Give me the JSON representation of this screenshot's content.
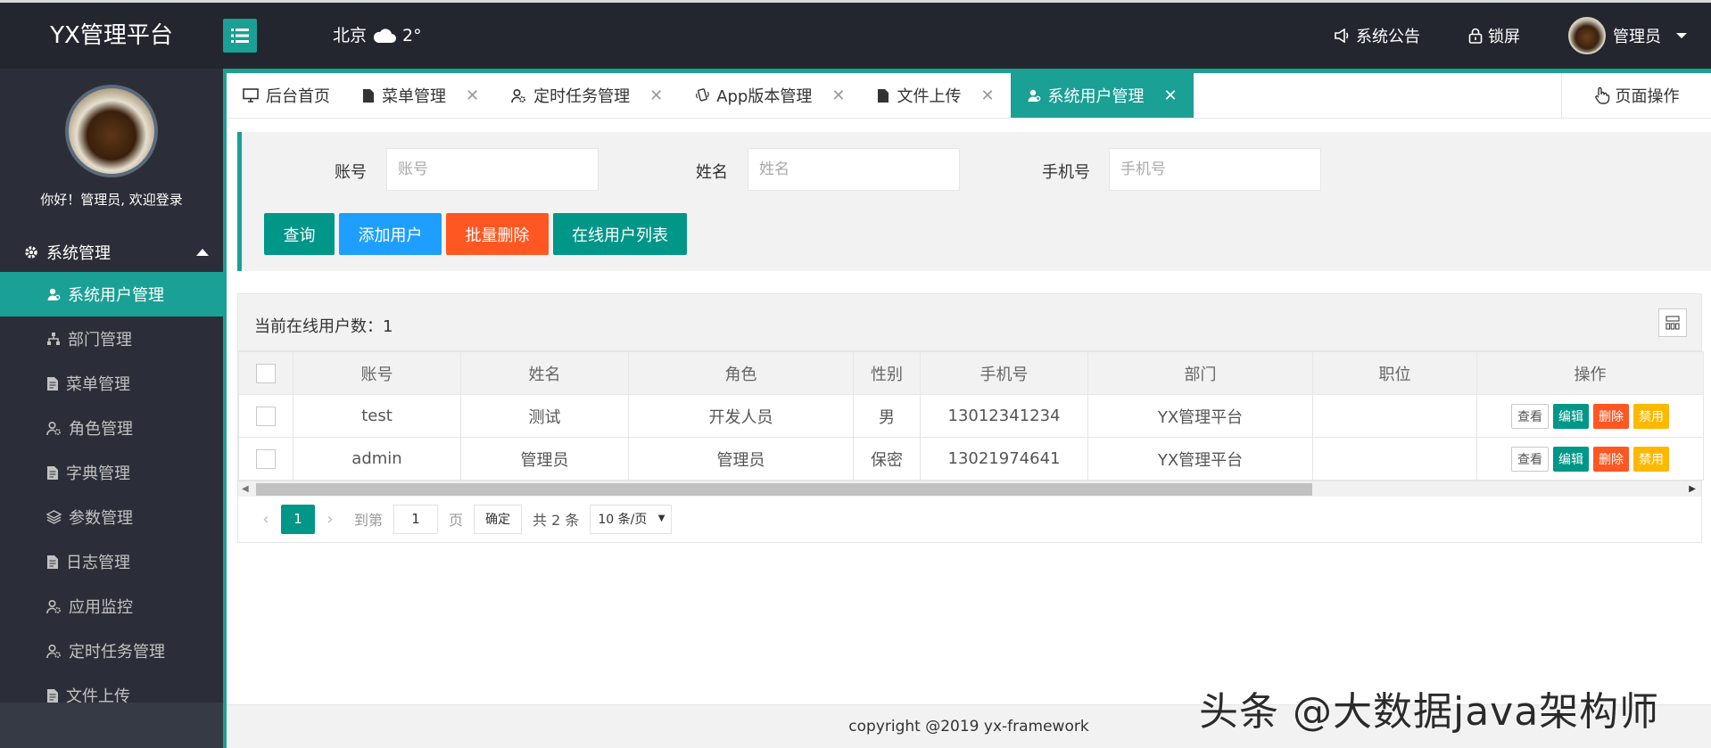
{
  "header": {
    "logo": "YX管理平台",
    "city": "北京",
    "temperature": "2°",
    "announcement": "系统公告",
    "lock": "锁屏",
    "user": "管理员"
  },
  "sidebar": {
    "welcome": "你好！管理员, 欢迎登录",
    "group": "系统管理",
    "items": [
      {
        "label": "系统用户管理",
        "icon": "user-icon",
        "active": true
      },
      {
        "label": "部门管理",
        "icon": "sitemap-icon"
      },
      {
        "label": "菜单管理",
        "icon": "file-icon"
      },
      {
        "label": "角色管理",
        "icon": "user-gear-icon"
      },
      {
        "label": "字典管理",
        "icon": "file-icon"
      },
      {
        "label": "参数管理",
        "icon": "layers-icon"
      },
      {
        "label": "日志管理",
        "icon": "file-icon"
      },
      {
        "label": "应用监控",
        "icon": "user-gear-icon"
      },
      {
        "label": "定时任务管理",
        "icon": "user-gear-icon"
      },
      {
        "label": "文件上传",
        "icon": "file-icon"
      }
    ]
  },
  "tabs": [
    {
      "label": "后台首页",
      "icon": "monitor-icon",
      "closable": false
    },
    {
      "label": "菜单管理",
      "icon": "file-icon",
      "closable": true
    },
    {
      "label": "定时任务管理",
      "icon": "user-gear-icon",
      "closable": true
    },
    {
      "label": "App版本管理",
      "icon": "mobile-icon",
      "closable": true
    },
    {
      "label": "文件上传",
      "icon": "file-icon",
      "closable": true
    },
    {
      "label": "系统用户管理",
      "icon": "user-icon",
      "closable": true,
      "active": true
    }
  ],
  "tab_close": "✕",
  "page_operation": "页面操作",
  "search": {
    "account_label": "账号",
    "account_placeholder": "账号",
    "name_label": "姓名",
    "name_placeholder": "姓名",
    "phone_label": "手机号",
    "phone_placeholder": "手机号",
    "btn_query": "查询",
    "btn_add": "添加用户",
    "btn_batch_delete": "批量删除",
    "btn_online_list": "在线用户列表"
  },
  "table": {
    "online_count": "当前在线用户数：1",
    "columns": [
      "账号",
      "姓名",
      "角色",
      "性别",
      "手机号",
      "部门",
      "职位",
      "操作"
    ],
    "rows": [
      {
        "account": "test",
        "name": "测试",
        "role": "开发人员",
        "gender": "男",
        "phone": "13012341234",
        "dept": "YX管理平台",
        "position": ""
      },
      {
        "account": "admin",
        "name": "管理员",
        "role": "管理员",
        "gender": "保密",
        "phone": "13021974641",
        "dept": "YX管理平台",
        "position": ""
      }
    ],
    "actions": {
      "view": "查看",
      "edit": "编辑",
      "delete": "删除",
      "disable": "禁用"
    }
  },
  "pager": {
    "current": "1",
    "goto": "到第",
    "input": "1",
    "page_unit": "页",
    "ok": "确定",
    "total": "共 2 条",
    "size": "10 条/页"
  },
  "footer": "copyright @2019 yx-framework",
  "watermark": "头条 @大数据java架构师",
  "colors": {
    "accent": "#1aa094",
    "primary": "#009688",
    "blue": "#1e9fff",
    "orange": "#ff5722",
    "yellow": "#ffb800",
    "dark": "#23262e"
  }
}
